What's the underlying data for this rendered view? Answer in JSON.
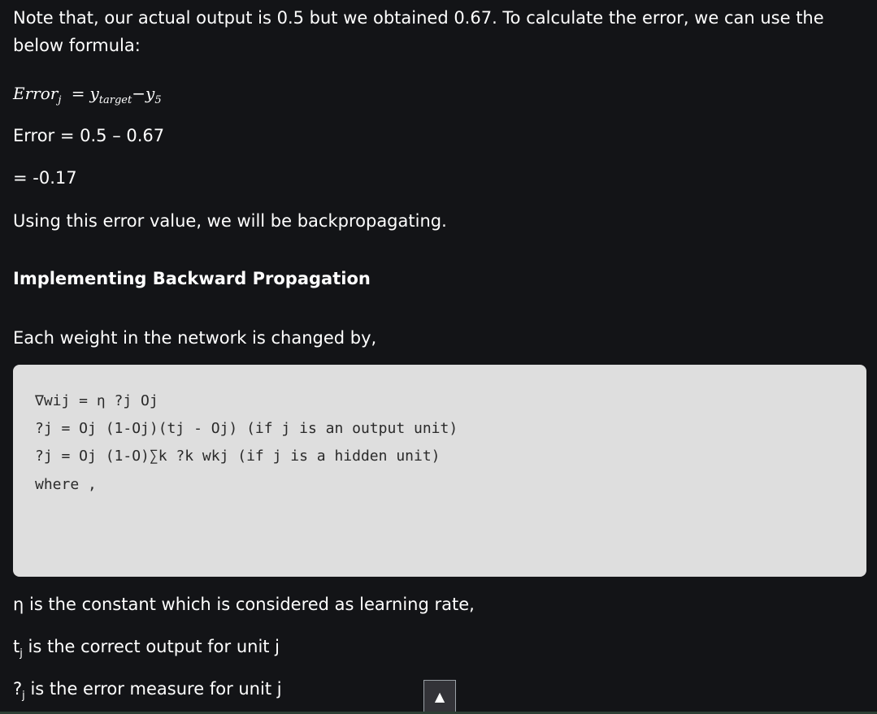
{
  "content": {
    "p_note": "Note that, our actual output is 0.5 but we obtained 0.67. To calculate the error, we can use the below formula:",
    "formula": {
      "lhs": "Error",
      "lhs_sub": "j",
      "equals": "=",
      "y1": "y",
      "y1_sub": "target",
      "minus": "−",
      "y2": "y",
      "y2_sub": "5"
    },
    "p_error": "Error = 0.5 – 0.67",
    "p_result": "= -0.17",
    "p_using": "Using this error value, we will be backpropagating.",
    "heading": "Implementing Backward Propagation",
    "p_each": "Each weight in the network is changed by,",
    "code_lines": [
      "∇wij = η ?j Oj",
      "?j = Oj (1-Oj)(tj - Oj) (if j is an output unit)",
      "?j = Oj (1-O)∑k ?k wkj (if j is a hidden unit)",
      "where ,"
    ],
    "p_eta": "η is the constant which is considered as learning rate,",
    "p_t_symbol": "t",
    "p_t_sub": "j",
    "p_t_text": " is the correct output for unit j",
    "p_q_symbol": "?",
    "p_q_sub": "j",
    "p_q_text": " is the error measure for unit j"
  },
  "scroll_top": {
    "icon": "up-arrow-icon",
    "glyph": "▲"
  }
}
